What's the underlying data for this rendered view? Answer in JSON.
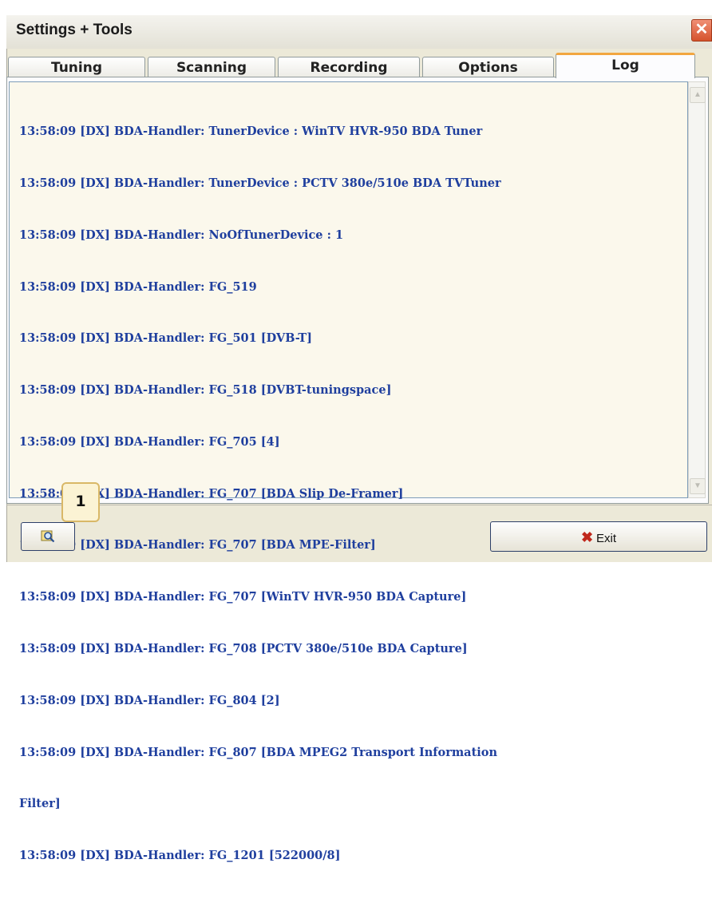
{
  "window": {
    "title": "Settings + Tools",
    "close_symbol": "✕"
  },
  "tabs": [
    {
      "label": "Tuning",
      "active": false
    },
    {
      "label": "Scanning",
      "active": false
    },
    {
      "label": "Recording",
      "active": false
    },
    {
      "label": "Options",
      "active": false
    },
    {
      "label": "Log",
      "active": true
    }
  ],
  "log": {
    "lines": [
      "13:58:09 [DX] BDA-Handler: TunerDevice : WinTV HVR-950 BDA Tuner",
      "13:58:09 [DX] BDA-Handler: TunerDevice : PCTV 380e/510e BDA TVTuner",
      "13:58:09 [DX] BDA-Handler: NoOfTunerDevice : 1",
      "13:58:09 [DX] BDA-Handler: FG_519",
      "13:58:09 [DX] BDA-Handler: FG_501 [DVB-T]",
      "13:58:09 [DX] BDA-Handler: FG_518 [DVBT-tuningspace]",
      "13:58:09 [DX] BDA-Handler: FG_705 [4]",
      "13:58:09 [DX] BDA-Handler: FG_707 [BDA Slip De-Framer]",
      "13:58:09 [DX] BDA-Handler: FG_707 [BDA MPE-Filter]",
      "13:58:09 [DX] BDA-Handler: FG_707 [WinTV HVR-950 BDA Capture]",
      "13:58:09 [DX] BDA-Handler: FG_708 [PCTV 380e/510e BDA Capture]",
      "13:58:09 [DX] BDA-Handler: FG_804 [2]",
      "13:58:09 [DX] BDA-Handler: FG_807 [BDA MPEG2 Transport Information",
      "Filter]",
      "13:58:09 [DX] BDA-Handler: FG_1201 [522000/8]"
    ]
  },
  "buttons": {
    "search_icon": "search-icon",
    "exit_label": "Exit",
    "exit_icon": "red-x-icon"
  },
  "callout": {
    "number": "1"
  },
  "colors": {
    "log_text": "#1f3f9e",
    "log_bg": "#fbf8ec",
    "tab_active_accent": "#f2a640"
  }
}
